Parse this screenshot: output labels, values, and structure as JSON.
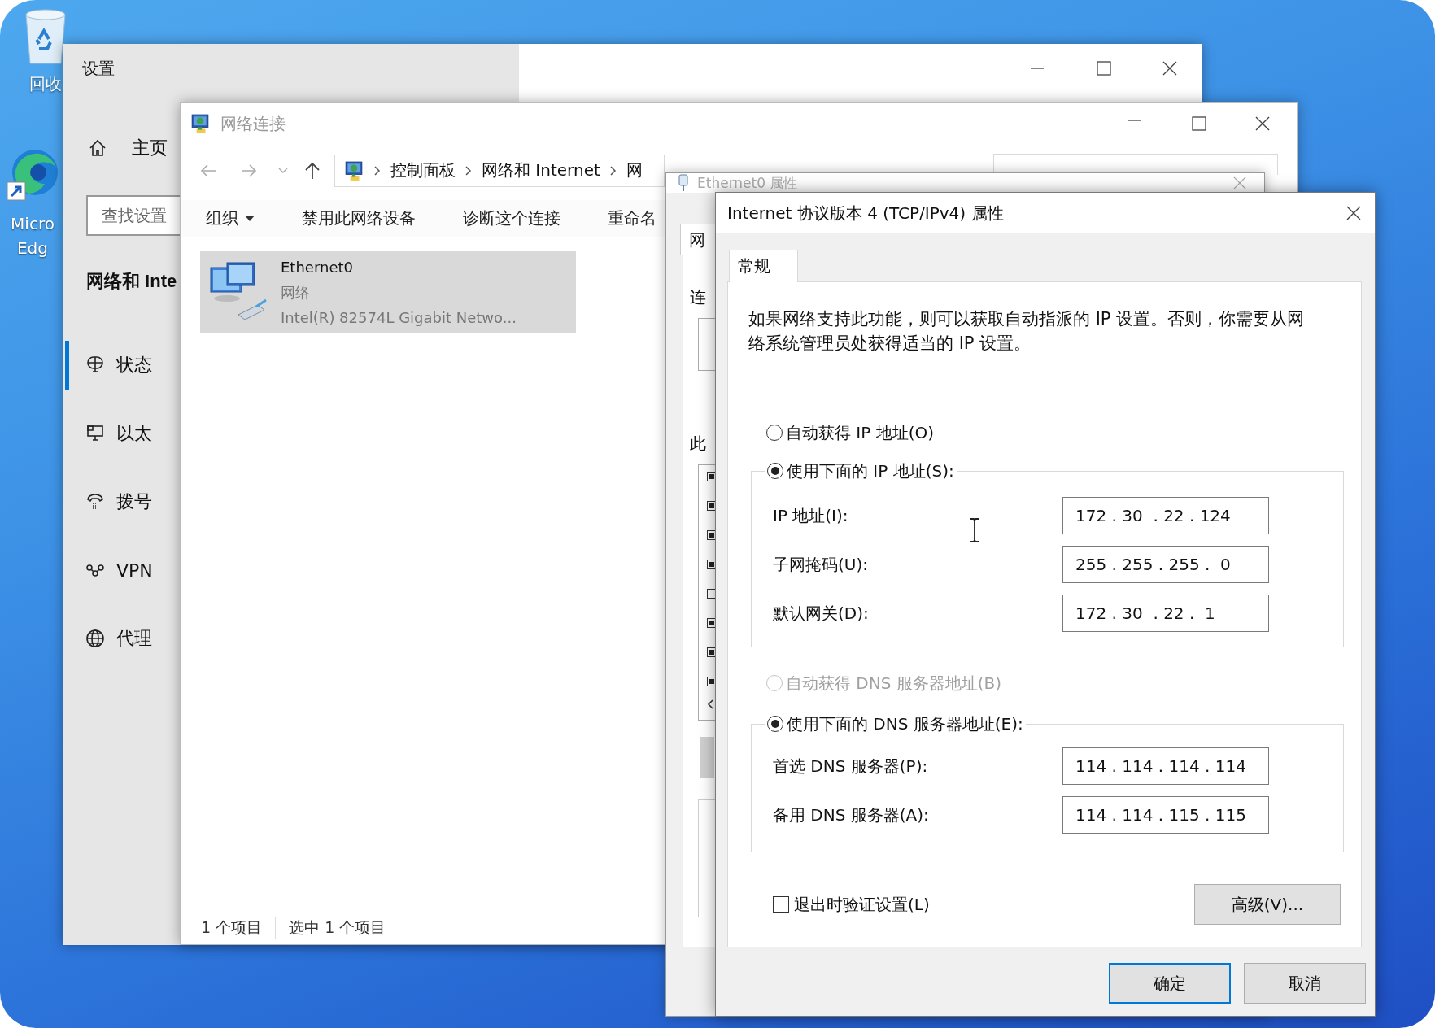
{
  "desktop_icons": [
    {
      "kind": "recycle-bin",
      "lines": [
        "回收"
      ]
    },
    {
      "kind": "browser",
      "lines": [
        "Micro",
        "Edg"
      ]
    }
  ],
  "settings_window": {
    "title": "设置",
    "home": "主页",
    "search": {
      "placeholder": "查找设置"
    },
    "section_title": "网络和 Inte",
    "nav": [
      {
        "label": "状态",
        "kind": "status",
        "selected": true
      },
      {
        "label": "以太",
        "kind": "ethernet",
        "selected": false
      },
      {
        "label": "拨号",
        "kind": "dialup",
        "selected": false
      },
      {
        "label": "VPN",
        "kind": "vpn",
        "selected": false
      },
      {
        "label": "代理",
        "kind": "proxy",
        "selected": false
      }
    ]
  },
  "network_connections_window": {
    "title": "网络连接",
    "breadcrumb": [
      "控制面板",
      "网络和 Internet",
      "网"
    ],
    "toolbar": [
      {
        "label": "组织",
        "kind": "menu"
      },
      {
        "label": "禁用此网络设备",
        "kind": "command"
      },
      {
        "label": "诊断这个连接",
        "kind": "command"
      },
      {
        "label": "重命名",
        "kind": "command"
      }
    ],
    "items": [
      {
        "name": "Ethernet0",
        "status": "网络",
        "device": "Intel(R) 82574L Gigabit Netwo...",
        "selected": true
      }
    ],
    "status_bar": [
      "1 个项目",
      "选中 1 个项目"
    ]
  },
  "ethernet_properties_window": {
    "title": "Ethernet0 属性",
    "tab": "网",
    "label_1": "连",
    "label_2": "此",
    "components": [
      {
        "checked": true
      },
      {
        "checked": true
      },
      {
        "checked": true
      },
      {
        "checked": true
      },
      {
        "checked": false
      },
      {
        "checked": true
      },
      {
        "checked": true
      },
      {
        "checked": true
      }
    ]
  },
  "ipv4_dialog": {
    "title": "Internet 协议版本 4 (TCP/IPv4) 属性",
    "tabs": [
      {
        "label": "常规",
        "selected": true
      }
    ],
    "description": "如果网络支持此功能，则可以获取自动指派的 IP 设置。否则，你需要从网络系统管理员处获得适当的 IP 设置。",
    "ip_mode": [
      {
        "label": "自动获得 IP 地址(O)",
        "selected": false
      },
      {
        "label": "使用下面的 IP 地址(S):",
        "selected": true
      }
    ],
    "ip_fields": [
      {
        "label": "IP 地址(I):",
        "value": "172 . 30  . 22 . 124"
      },
      {
        "label": "子网掩码(U):",
        "value": "255 . 255 . 255 .  0"
      },
      {
        "label": "默认网关(D):",
        "value": "172 . 30  . 22 .  1"
      }
    ],
    "dns_mode": [
      {
        "label": "自动获得 DNS 服务器地址(B)",
        "selected": false,
        "disabled": true
      },
      {
        "label": "使用下面的 DNS 服务器地址(E):",
        "selected": true,
        "disabled": false
      }
    ],
    "dns_fields": [
      {
        "label": "首选 DNS 服务器(P):",
        "value": "114 . 114 . 114 . 114"
      },
      {
        "label": "备用 DNS 服务器(A):",
        "value": "114 . 114 . 115 . 115"
      }
    ],
    "validate_on_exit": {
      "label": "退出时验证设置(L)",
      "checked": false
    },
    "advanced_button": "高级(V)...",
    "buttons": [
      {
        "label": "确定",
        "default": true
      },
      {
        "label": "取消",
        "default": false
      }
    ]
  }
}
